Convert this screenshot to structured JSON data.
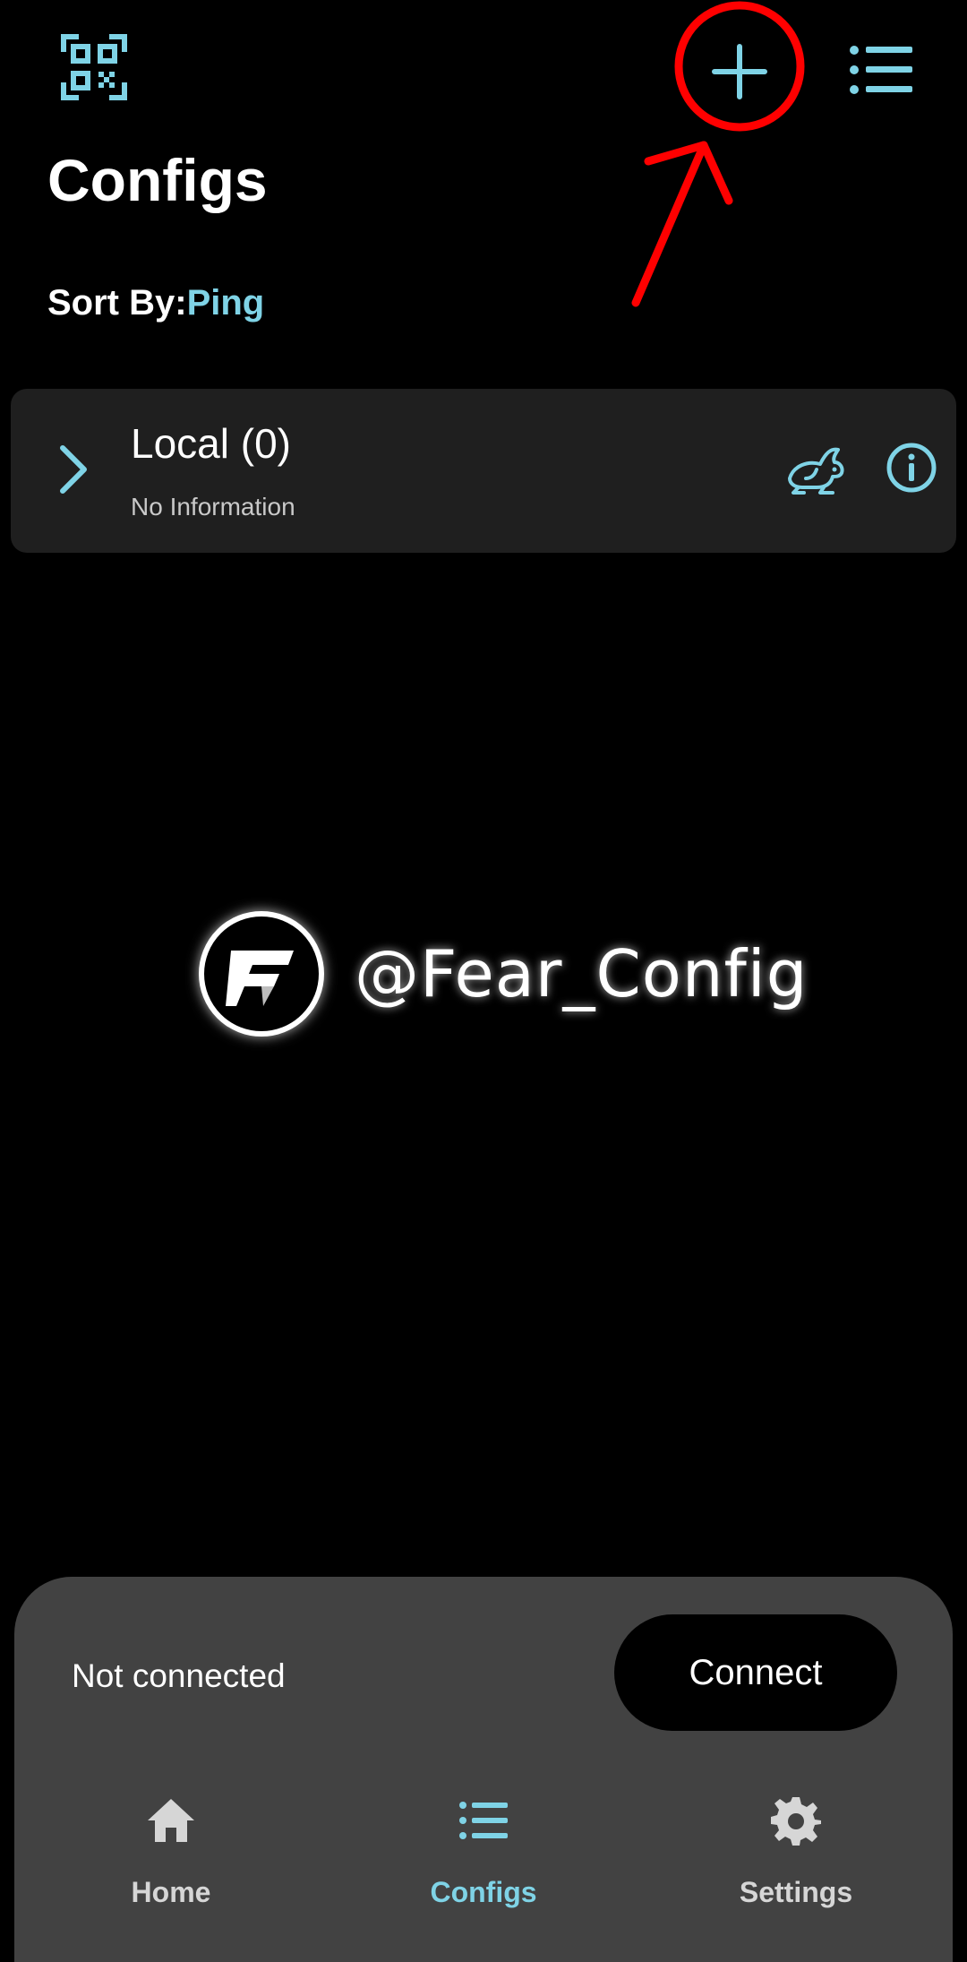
{
  "colors": {
    "accent": "#7fd3e6",
    "background": "#000000",
    "card": "#1f1f1f",
    "sheet": "#424242",
    "annotation": "#ff0000"
  },
  "top_bar": {
    "scan_icon": "qr-scan-icon",
    "add_icon": "plus-icon",
    "menu_icon": "list-icon"
  },
  "page": {
    "title": "Configs"
  },
  "sort": {
    "label": "Sort By:",
    "value": "Ping"
  },
  "groups": [
    {
      "title": "Local (0)",
      "subtitle": "No Information",
      "icons": [
        "chevron-right-icon",
        "rabbit-icon",
        "info-icon"
      ]
    }
  ],
  "watermark": {
    "text": "@Fear_Config"
  },
  "bottom": {
    "status": "Not connected",
    "connect_label": "Connect"
  },
  "nav": {
    "items": [
      {
        "label": "Home",
        "icon": "home-icon",
        "active": false
      },
      {
        "label": "Configs",
        "icon": "list-icon",
        "active": true
      },
      {
        "label": "Settings",
        "icon": "gear-icon",
        "active": false
      }
    ]
  }
}
